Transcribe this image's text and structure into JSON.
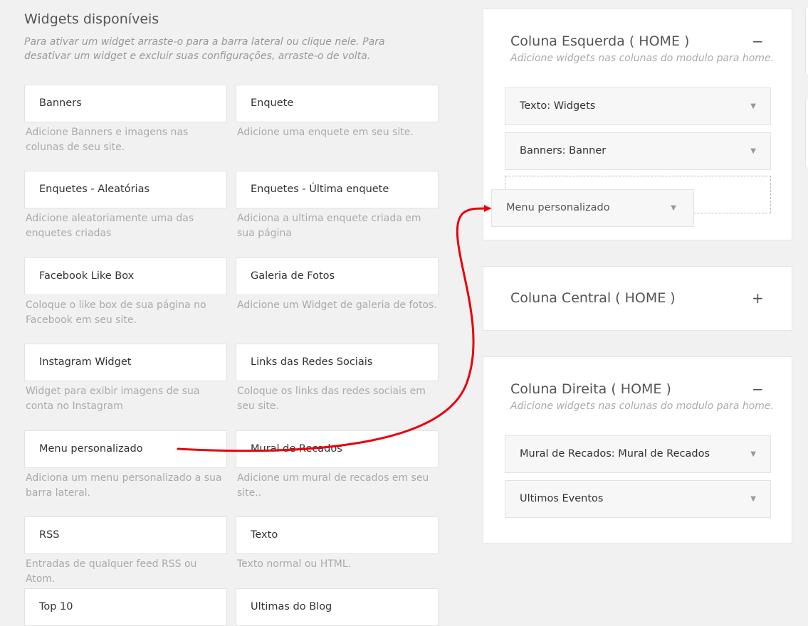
{
  "available": {
    "title": "Widgets disponíveis",
    "description": "Para ativar um widget arraste-o para a barra lateral ou clique nele. Para desativar um widget e excluir suas configurações, arraste-o de volta.",
    "widgets": [
      {
        "label": "Banners",
        "description": "Adicione Banners e imagens nas colunas de seu site."
      },
      {
        "label": "Enquete",
        "description": "Adicione uma enquete em seu site."
      },
      {
        "label": "Enquetes - Aleatórias",
        "description": "Adicione aleatoriamente uma das enquetes criadas"
      },
      {
        "label": "Enquetes - Última enquete",
        "description": "Adiciona a ultima enquete criada em sua página"
      },
      {
        "label": "Facebook Like Box",
        "description": "Coloque o like box de sua página no Facebook em seu site."
      },
      {
        "label": "Galeria de Fotos",
        "description": "Adicione um Widget de galeria de fotos."
      },
      {
        "label": "Instagram Widget",
        "description": "Widget para exibir imagens de sua conta no Instagram"
      },
      {
        "label": "Links das Redes Sociais",
        "description": "Coloque os links das redes sociais em seu site."
      },
      {
        "label": "Menu personalizado",
        "description": "Adiciona um menu personalizado a sua barra lateral."
      },
      {
        "label": "Mural de Recados",
        "description": "Adicione um mural de recados em seu site.."
      },
      {
        "label": "RSS",
        "description": "Entradas de qualquer feed RSS ou Atom."
      },
      {
        "label": "Texto",
        "description": "Texto normal ou HTML."
      },
      {
        "label": "Top 10",
        "description": ""
      },
      {
        "label": "Ultimas do Blog",
        "description": ""
      }
    ]
  },
  "sidebars": [
    {
      "title": "Coluna Esquerda ( HOME )",
      "description": "Adicione widgets nas colunas do modulo para home.",
      "toggle": "−",
      "widgets": [
        "Texto: Widgets",
        "Banners: Banner"
      ]
    },
    {
      "title": "Coluna Central ( HOME )",
      "description": "",
      "toggle": "+",
      "widgets": []
    },
    {
      "title": "Coluna Direita ( HOME )",
      "description": "Adicione widgets nas colunas do modulo para home.",
      "toggle": "−",
      "widgets": [
        "Mural de Recados: Mural de Recados",
        "Ultimos Eventos"
      ]
    }
  ],
  "dragging": {
    "label": "Menu personalizado"
  },
  "icons": {
    "caret": "▼",
    "annotation_arrow_color": "#e8000b"
  }
}
